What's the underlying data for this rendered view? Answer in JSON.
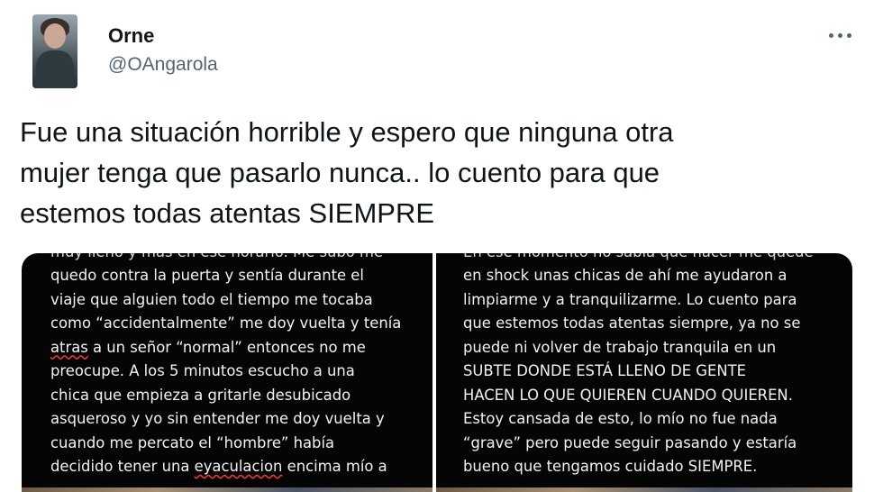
{
  "author": {
    "display_name": "Orne",
    "handle": "@OAngarola",
    "avatar_icon": "profile-photo"
  },
  "menu": {
    "icon": "more-horizontal-icon"
  },
  "tweet": {
    "text": "Fue una situación horrible y espero que ninguna otra\nmujer tenga que pasarlo nunca.. lo cuento para que\nestemos todas atentas SIEMPRE"
  },
  "media": {
    "left_panel": {
      "cut_line": "muy lleno y más en ese horario. Me subo me",
      "lines": [
        "quedo contra la puerta y sentía durante el",
        "viaje que alguien todo el tiempo me tocaba",
        "como “accidentalmente” me doy vuelta y tenía",
        {
          "before": "",
          "squiggle": "atras",
          "after": " a un señor “normal” entonces no me"
        },
        "preocupe. A los 5 minutos escucho a una",
        "chica que empieza a gritarle desubicado",
        "asqueroso y yo sin entender me doy vuelta y",
        "cuando me percato el “hombre” había",
        {
          "before": "decidido tener una ",
          "squiggle": "eyaculacion",
          "after": " encima mío a"
        }
      ]
    },
    "right_panel": {
      "cut_line": "En ese momento no sabía que hacer me quede",
      "lines": [
        "en shock unas chicas de ahí me ayudaron a",
        "limpiarme y a tranquilizarme. Lo cuento para",
        "que estemos todas atentas siempre, ya no se",
        "puede ni volver de trabajo tranquila en un",
        "SUBTE DONDE ESTÁ LLENO DE GENTE",
        "HACEN LO QUE QUIEREN CUANDO QUIEREN.",
        "Estoy cansada de esto, lo mío no fue nada",
        "“grave” pero puede seguir pasando y estaría",
        "bueno que tengamos cuidado SIEMPRE."
      ]
    }
  }
}
